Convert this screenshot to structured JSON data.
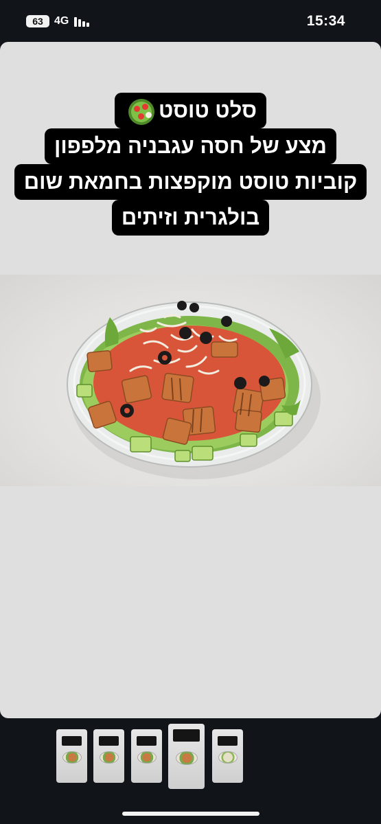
{
  "status_bar": {
    "battery": "63",
    "network": "4G",
    "time": "15:34"
  },
  "story": {
    "caption_lines": [
      "סלט טוסט",
      "מצע של חסה עגבניה מלפפון",
      "קוביות טוסט מוקפצות בחמאת שום",
      "בולגרית וזיתים"
    ],
    "caption_emoji": "salad-bowl-icon",
    "image": "salad-toast-bowl-photo"
  },
  "thumbnails": {
    "count": 5,
    "active_index": 3
  },
  "colors": {
    "background": "#111419",
    "card": "#dfdfdf",
    "caption_bg": "#000000",
    "caption_text": "#ffffff"
  }
}
